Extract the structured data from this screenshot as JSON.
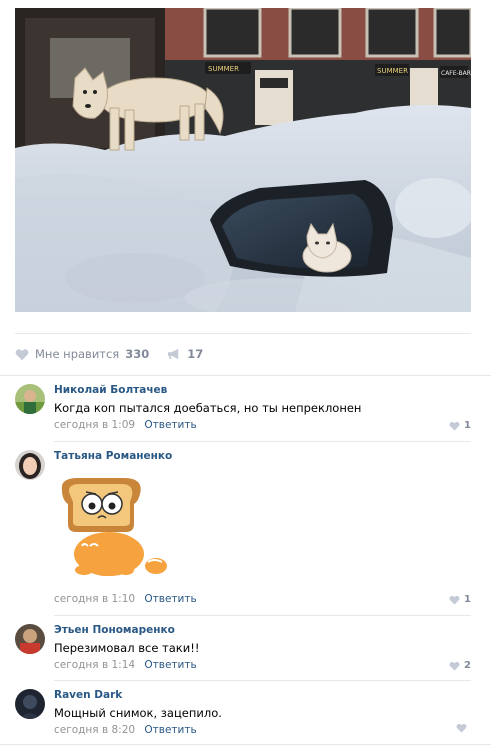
{
  "post": {
    "likes_label": "Мне нравится",
    "likes_count": "330",
    "shares_count": "17",
    "photo_shop_signs": [
      "SUMMER",
      "SUMMER",
      "CAFE-BAR"
    ]
  },
  "colors": {
    "link": "#2a5885",
    "meta": "#939393",
    "icon": "#c4cbd6",
    "separator": "#e7e8ec"
  },
  "comments": [
    {
      "author": "Николай Болтачев",
      "text": "Когда коп пытался доебаться, но ты непреклонен",
      "time": "сегодня в 1:09",
      "reply": "Ответить",
      "likes": "1"
    },
    {
      "author": "Татьяна Романенко",
      "sticker": "cat-in-bread-sticker",
      "time": "сегодня в 1:10",
      "reply": "Ответить",
      "likes": "1"
    },
    {
      "author": "Этьен Пономаренко",
      "text": "Перезимовал все таки!!",
      "time": "сегодня в 1:14",
      "reply": "Ответить",
      "likes": "2"
    },
    {
      "author": "Raven Dark",
      "text": "Мощный снимок, зацепило.",
      "time": "сегодня в 8:20",
      "reply": "Ответить",
      "likes": ""
    }
  ]
}
